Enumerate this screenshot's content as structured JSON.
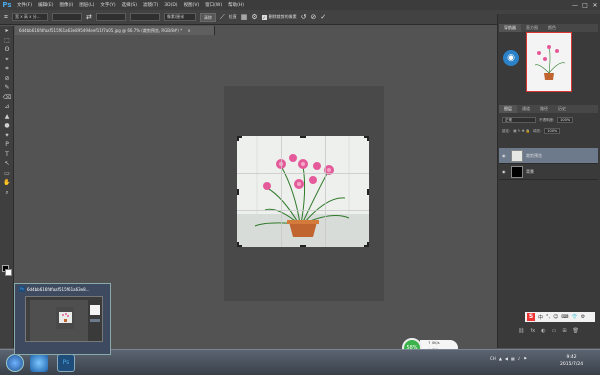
{
  "menubar": {
    "logo": "Ps",
    "items": [
      "文件(F)",
      "编辑(E)",
      "图像(I)",
      "图层(L)",
      "文字(Y)",
      "选择(S)",
      "滤镜(T)",
      "3D(D)",
      "视图(V)",
      "窗口(W)",
      "帮助(H)"
    ],
    "controls": [
      "—",
      "□",
      "✕"
    ]
  },
  "options": {
    "tool_icon": "⌗",
    "ratio_select": "宽 x 高 x 分...",
    "swap_icon": "⇄",
    "units_select": "像素/厘米",
    "clear_button": "清除",
    "straighten_label": "拉直",
    "grid_icon": "▦",
    "settings_icon": "⚙",
    "delete_cropped_label": "删除裁剪的像素",
    "reset_icon": "↺",
    "cancel_icon": "⊘",
    "commit_icon": "✓"
  },
  "document": {
    "tab_title": "6d4bb616fdfaaf515f61a63e895494eef11f7a05.jpg @ 66.7% (裁剪预览, RGB/8#) *",
    "close": "×"
  },
  "toolbox": {
    "tools": [
      "▸",
      "⬚",
      "ʘ",
      "⌖",
      "⌗",
      "⊘",
      "✎",
      "⌫",
      "⊿",
      "▲",
      "●",
      "✦",
      "P",
      "T",
      "↖",
      "▭",
      "✋",
      "⌕"
    ]
  },
  "panels": {
    "nav_tabs": [
      "导航器",
      "直方图",
      "颜色"
    ],
    "wifi_icon": "◉",
    "layers_tabs": [
      "图层",
      "通道",
      "路径",
      "历史"
    ],
    "blend_mode": "正常",
    "opacity_label": "不透明度:",
    "opacity_value": "100%",
    "lock_label": "锁定:",
    "fill_label": "填充:",
    "fill_value": "100%",
    "layers": [
      {
        "name": "裁剪预览",
        "selected": true
      },
      {
        "name": "背景",
        "selected": false
      }
    ],
    "footer_icons": [
      "⛓",
      "fx",
      "◐",
      "▭",
      "⊞",
      "🗑"
    ],
    "ime": {
      "logo": "S",
      "items": [
        "中",
        "°,",
        "☺",
        "⌨",
        "👕",
        "⚙"
      ]
    }
  },
  "thumbnail": {
    "title": "6d4bb616fdfaaf515f61a63e8...",
    "app": "Ps"
  },
  "speed": {
    "percent": "58%",
    "up": "0K/s",
    "down": "0K/s"
  },
  "taskbar": {
    "tray": [
      "CH",
      "▲",
      "◀",
      "▦",
      "♪",
      "⚑"
    ],
    "time": "9:42",
    "date": "2015/7/24"
  },
  "colors": {
    "accent": "#4aa8e6",
    "selected_layer": "#6c7a8c",
    "speed_green": "#3bb24a"
  }
}
